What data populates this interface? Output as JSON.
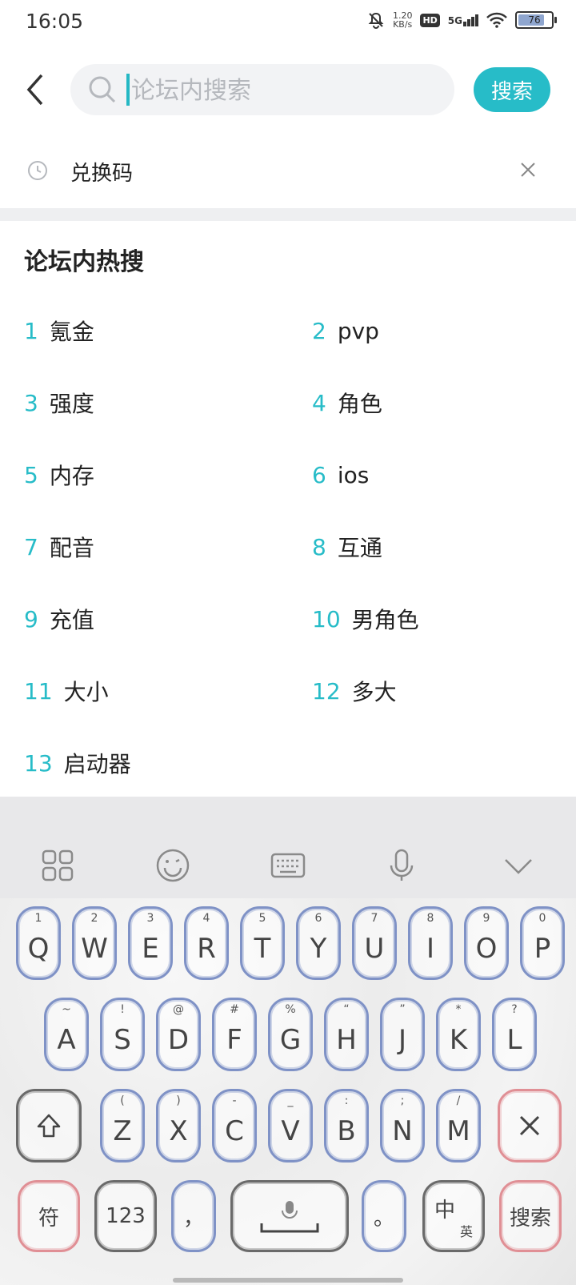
{
  "status": {
    "time": "16:05",
    "net_speed_value": "1.20",
    "net_speed_unit": "KB/s",
    "hd": "HD",
    "network": "5G",
    "battery": "76"
  },
  "search": {
    "placeholder": "论坛内搜索",
    "button": "搜索"
  },
  "history": {
    "items": [
      "兑换码"
    ]
  },
  "hot": {
    "title": "论坛内热搜",
    "items": [
      {
        "rank": "1",
        "keyword": "氪金"
      },
      {
        "rank": "2",
        "keyword": "pvp"
      },
      {
        "rank": "3",
        "keyword": "强度"
      },
      {
        "rank": "4",
        "keyword": "角色"
      },
      {
        "rank": "5",
        "keyword": "内存"
      },
      {
        "rank": "6",
        "keyword": "ios"
      },
      {
        "rank": "7",
        "keyword": "配音"
      },
      {
        "rank": "8",
        "keyword": "互通"
      },
      {
        "rank": "9",
        "keyword": "充值"
      },
      {
        "rank": "10",
        "keyword": "男角色"
      },
      {
        "rank": "11",
        "keyword": "大小"
      },
      {
        "rank": "12",
        "keyword": "多大"
      },
      {
        "rank": "13",
        "keyword": "启动器"
      }
    ]
  },
  "keyboard": {
    "toolbar": [
      "apps-grid-icon",
      "emoji-icon",
      "keyboard-icon",
      "microphone-icon",
      "chevron-down-icon"
    ],
    "row1": [
      {
        "main": "Q",
        "sub": "1"
      },
      {
        "main": "W",
        "sub": "2"
      },
      {
        "main": "E",
        "sub": "3"
      },
      {
        "main": "R",
        "sub": "4"
      },
      {
        "main": "T",
        "sub": "5"
      },
      {
        "main": "Y",
        "sub": "6"
      },
      {
        "main": "U",
        "sub": "7"
      },
      {
        "main": "I",
        "sub": "8"
      },
      {
        "main": "O",
        "sub": "9"
      },
      {
        "main": "P",
        "sub": "0"
      }
    ],
    "row2": [
      {
        "main": "A",
        "sub": "~"
      },
      {
        "main": "S",
        "sub": "!"
      },
      {
        "main": "D",
        "sub": "@"
      },
      {
        "main": "F",
        "sub": "#"
      },
      {
        "main": "G",
        "sub": "%"
      },
      {
        "main": "H",
        "sub": "“"
      },
      {
        "main": "J",
        "sub": "”"
      },
      {
        "main": "K",
        "sub": "*"
      },
      {
        "main": "L",
        "sub": "?"
      }
    ],
    "row3": [
      {
        "main": "Z",
        "sub": "("
      },
      {
        "main": "X",
        "sub": ")"
      },
      {
        "main": "C",
        "sub": "-"
      },
      {
        "main": "V",
        "sub": "_"
      },
      {
        "main": "B",
        "sub": ":"
      },
      {
        "main": "N",
        "sub": ";"
      },
      {
        "main": "M",
        "sub": "/"
      }
    ],
    "symbols": "符",
    "numbers": "123",
    "comma": "，",
    "period": "。",
    "lang_main": "中",
    "lang_sub": "英",
    "enter": "搜索"
  },
  "colors": {
    "accent": "#27bcc8",
    "key_border_blue": "#7f92c6",
    "key_border_red": "#e08f95"
  }
}
